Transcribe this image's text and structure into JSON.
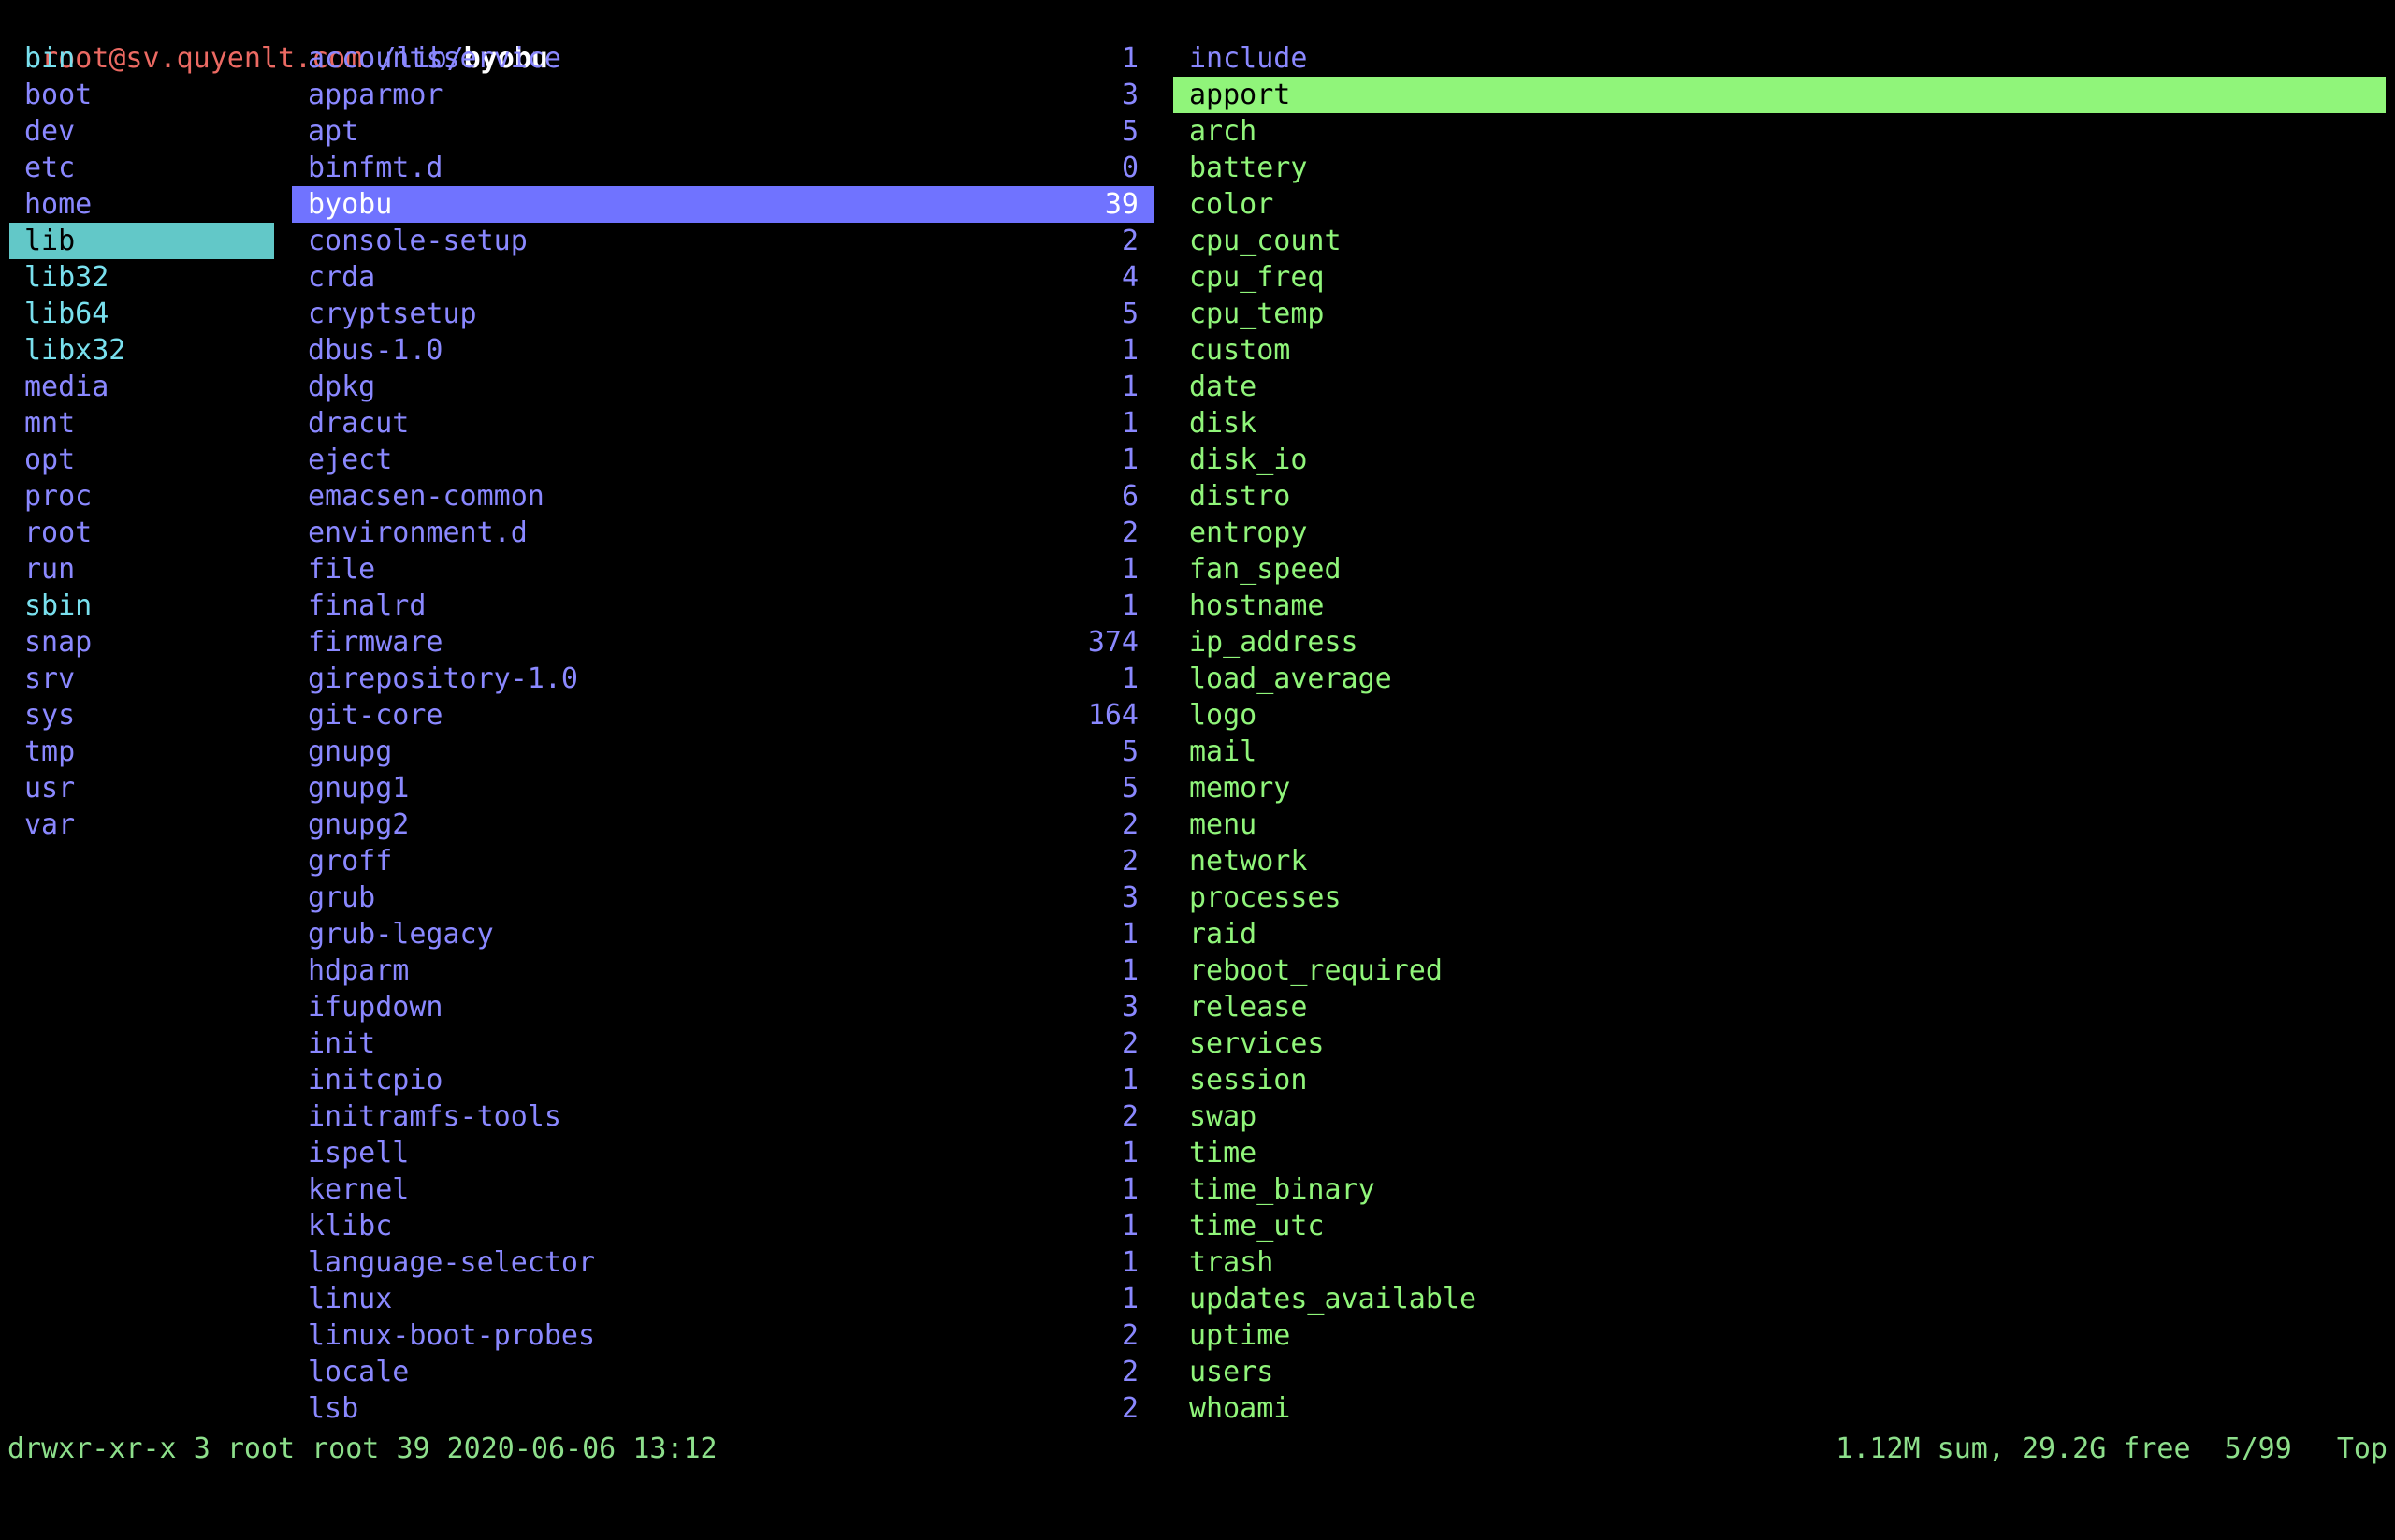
{
  "title": {
    "host": "root@sv.quyenlt.com",
    "path_dir": "/lib/",
    "path_current": "byobu"
  },
  "colors": {
    "host": "#ec6a63",
    "directory": "#8a88ff",
    "symlink": "#79e0ee",
    "file": "#90f57a",
    "selected_parent": "#62c8c8",
    "selected_current": "#7073ff",
    "selected_preview": "#90f57a",
    "status": "#8ddf8b"
  },
  "left": [
    {
      "name": "bin",
      "type": "link"
    },
    {
      "name": "boot",
      "type": "dir"
    },
    {
      "name": "dev",
      "type": "dir"
    },
    {
      "name": "etc",
      "type": "dir"
    },
    {
      "name": "home",
      "type": "dir"
    },
    {
      "name": "lib",
      "type": "link",
      "selected": true
    },
    {
      "name": "lib32",
      "type": "link"
    },
    {
      "name": "lib64",
      "type": "link"
    },
    {
      "name": "libx32",
      "type": "link"
    },
    {
      "name": "media",
      "type": "dir"
    },
    {
      "name": "mnt",
      "type": "dir"
    },
    {
      "name": "opt",
      "type": "dir"
    },
    {
      "name": "proc",
      "type": "dir"
    },
    {
      "name": "root",
      "type": "dir"
    },
    {
      "name": "run",
      "type": "dir"
    },
    {
      "name": "sbin",
      "type": "link"
    },
    {
      "name": "snap",
      "type": "dir"
    },
    {
      "name": "srv",
      "type": "dir"
    },
    {
      "name": "sys",
      "type": "dir"
    },
    {
      "name": "tmp",
      "type": "dir"
    },
    {
      "name": "usr",
      "type": "dir"
    },
    {
      "name": "var",
      "type": "dir"
    }
  ],
  "middle": [
    {
      "name": "accountsservice",
      "count": "1"
    },
    {
      "name": "apparmor",
      "count": "3"
    },
    {
      "name": "apt",
      "count": "5"
    },
    {
      "name": "binfmt.d",
      "count": "0"
    },
    {
      "name": "byobu",
      "count": "39",
      "selected": true
    },
    {
      "name": "console-setup",
      "count": "2"
    },
    {
      "name": "crda",
      "count": "4"
    },
    {
      "name": "cryptsetup",
      "count": "5"
    },
    {
      "name": "dbus-1.0",
      "count": "1"
    },
    {
      "name": "dpkg",
      "count": "1"
    },
    {
      "name": "dracut",
      "count": "1"
    },
    {
      "name": "eject",
      "count": "1"
    },
    {
      "name": "emacsen-common",
      "count": "6"
    },
    {
      "name": "environment.d",
      "count": "2"
    },
    {
      "name": "file",
      "count": "1"
    },
    {
      "name": "finalrd",
      "count": "1"
    },
    {
      "name": "firmware",
      "count": "374"
    },
    {
      "name": "girepository-1.0",
      "count": "1"
    },
    {
      "name": "git-core",
      "count": "164"
    },
    {
      "name": "gnupg",
      "count": "5"
    },
    {
      "name": "gnupg1",
      "count": "5"
    },
    {
      "name": "gnupg2",
      "count": "2"
    },
    {
      "name": "groff",
      "count": "2"
    },
    {
      "name": "grub",
      "count": "3"
    },
    {
      "name": "grub-legacy",
      "count": "1"
    },
    {
      "name": "hdparm",
      "count": "1"
    },
    {
      "name": "ifupdown",
      "count": "3"
    },
    {
      "name": "init",
      "count": "2"
    },
    {
      "name": "initcpio",
      "count": "1"
    },
    {
      "name": "initramfs-tools",
      "count": "2"
    },
    {
      "name": "ispell",
      "count": "1"
    },
    {
      "name": "kernel",
      "count": "1"
    },
    {
      "name": "klibc",
      "count": "1"
    },
    {
      "name": "language-selector",
      "count": "1"
    },
    {
      "name": "linux",
      "count": "1"
    },
    {
      "name": "linux-boot-probes",
      "count": "2"
    },
    {
      "name": "locale",
      "count": "2"
    },
    {
      "name": "lsb",
      "count": "2"
    }
  ],
  "right": [
    {
      "name": "include",
      "type": "dir"
    },
    {
      "name": "apport",
      "type": "file",
      "selected": true
    },
    {
      "name": "arch",
      "type": "file"
    },
    {
      "name": "battery",
      "type": "file"
    },
    {
      "name": "color",
      "type": "file"
    },
    {
      "name": "cpu_count",
      "type": "file"
    },
    {
      "name": "cpu_freq",
      "type": "file"
    },
    {
      "name": "cpu_temp",
      "type": "file"
    },
    {
      "name": "custom",
      "type": "file"
    },
    {
      "name": "date",
      "type": "file"
    },
    {
      "name": "disk",
      "type": "file"
    },
    {
      "name": "disk_io",
      "type": "file"
    },
    {
      "name": "distro",
      "type": "file"
    },
    {
      "name": "entropy",
      "type": "file"
    },
    {
      "name": "fan_speed",
      "type": "file"
    },
    {
      "name": "hostname",
      "type": "file"
    },
    {
      "name": "ip_address",
      "type": "file"
    },
    {
      "name": "load_average",
      "type": "file"
    },
    {
      "name": "logo",
      "type": "file"
    },
    {
      "name": "mail",
      "type": "file"
    },
    {
      "name": "memory",
      "type": "file"
    },
    {
      "name": "menu",
      "type": "file"
    },
    {
      "name": "network",
      "type": "file"
    },
    {
      "name": "processes",
      "type": "file"
    },
    {
      "name": "raid",
      "type": "file"
    },
    {
      "name": "reboot_required",
      "type": "file"
    },
    {
      "name": "release",
      "type": "file"
    },
    {
      "name": "services",
      "type": "file"
    },
    {
      "name": "session",
      "type": "file"
    },
    {
      "name": "swap",
      "type": "file"
    },
    {
      "name": "time",
      "type": "file"
    },
    {
      "name": "time_binary",
      "type": "file"
    },
    {
      "name": "time_utc",
      "type": "file"
    },
    {
      "name": "trash",
      "type": "file"
    },
    {
      "name": "updates_available",
      "type": "file"
    },
    {
      "name": "uptime",
      "type": "file"
    },
    {
      "name": "users",
      "type": "file"
    },
    {
      "name": "whoami",
      "type": "file"
    }
  ],
  "status": {
    "permissions": "drwxr-xr-x",
    "links": "3",
    "owner": "root",
    "group": "root",
    "size": "39",
    "date": "2020-06-06",
    "time": "13:12",
    "disk_usage": "1.12M sum, 29.2G free",
    "position": "5/99",
    "scroll": "Top"
  }
}
